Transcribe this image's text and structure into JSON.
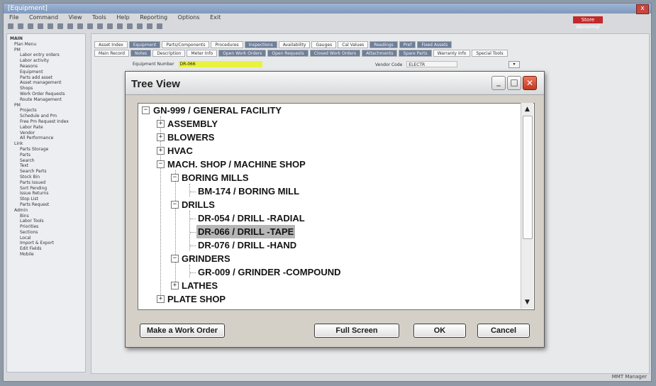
{
  "app": {
    "title": "[Equipment]",
    "close_glyph": "x",
    "alert_label": "Store Abnormal",
    "menu": [
      "File",
      "Command",
      "View",
      "Tools",
      "Help",
      "Reporting",
      "Options",
      "Exit"
    ],
    "status_text": "MMT Manager"
  },
  "sidebar": {
    "items": [
      {
        "label": "MAIN",
        "level": 0
      },
      {
        "label": "Plan Menu",
        "level": 1
      },
      {
        "label": "PM",
        "level": 1
      },
      {
        "label": "Labor entry orders",
        "level": 2
      },
      {
        "label": "Labor activity",
        "level": 2
      },
      {
        "label": "Reasons",
        "level": 2
      },
      {
        "label": "Equipment",
        "level": 2
      },
      {
        "label": "Parts add asset",
        "level": 2
      },
      {
        "label": "Asset management",
        "level": 2
      },
      {
        "label": "Shops",
        "level": 2
      },
      {
        "label": "Work Order Requests",
        "level": 2
      },
      {
        "label": "Route Management",
        "level": 2
      },
      {
        "label": "PM",
        "level": 1
      },
      {
        "label": "Projects",
        "level": 2
      },
      {
        "label": "Schedule and Pm",
        "level": 2
      },
      {
        "label": "Free Pm Request Index",
        "level": 2
      },
      {
        "label": "Labor Rate",
        "level": 2
      },
      {
        "label": "Vendor",
        "level": 2
      },
      {
        "label": "All Performance",
        "level": 2
      },
      {
        "label": "Link",
        "level": 1
      },
      {
        "label": "Parts Storage",
        "level": 2
      },
      {
        "label": "Parts",
        "level": 2
      },
      {
        "label": "Search",
        "level": 2
      },
      {
        "label": "Text",
        "level": 2
      },
      {
        "label": "Search Parts",
        "level": 2
      },
      {
        "label": "Stock Bin",
        "level": 2
      },
      {
        "label": "Parts Issued",
        "level": 2
      },
      {
        "label": "Sort Pending",
        "level": 2
      },
      {
        "label": "Issue Returns",
        "level": 2
      },
      {
        "label": "Stop List",
        "level": 2
      },
      {
        "label": "Parts Request",
        "level": 2
      },
      {
        "label": "Admin",
        "level": 1
      },
      {
        "label": "Bins",
        "level": 2
      },
      {
        "label": "Labor Tools",
        "level": 2
      },
      {
        "label": "Priorities",
        "level": 2
      },
      {
        "label": "Sections",
        "level": 2
      },
      {
        "label": "Local",
        "level": 2
      },
      {
        "label": "Import & Export",
        "level": 2
      },
      {
        "label": "Edit Fields",
        "level": 2
      },
      {
        "label": "Mobile",
        "level": 2
      }
    ]
  },
  "main": {
    "tabs_row1": [
      {
        "label": "Asset Index",
        "dark": false
      },
      {
        "label": "Equipment",
        "dark": true
      },
      {
        "label": "Parts/Components",
        "dark": false
      },
      {
        "label": "Procedures",
        "dark": false
      },
      {
        "label": "Inspections",
        "dark": true
      },
      {
        "label": "Availability",
        "dark": false
      },
      {
        "label": "Gauges",
        "dark": false
      },
      {
        "label": "Cal Values",
        "dark": false
      },
      {
        "label": "Readings",
        "dark": true
      },
      {
        "label": "Pref",
        "dark": true
      },
      {
        "label": "Fixed Assets",
        "dark": true
      }
    ],
    "tabs_row2": [
      {
        "label": "Main Record",
        "dark": false
      },
      {
        "label": "Notes",
        "dark": true
      },
      {
        "label": "Description",
        "dark": false
      },
      {
        "label": "Meter Info",
        "dark": false
      },
      {
        "label": "Open Work Orders",
        "dark": true
      },
      {
        "label": "Open Requests",
        "dark": true
      },
      {
        "label": "Closed Work Orders",
        "dark": true
      },
      {
        "label": "Attachments",
        "dark": true
      },
      {
        "label": "Spare Parts",
        "dark": true
      },
      {
        "label": "Warranty Info",
        "dark": false
      },
      {
        "label": "Special Tools",
        "dark": false
      }
    ],
    "equipment_number_label": "Equipment Number",
    "equipment_number_value": "DR-066",
    "vendor_code_label": "Vendor Code",
    "vendor_code_value": "ELECTR",
    "vendor_arrow": "▾"
  },
  "dialog": {
    "title": "Tree View",
    "min_glyph": "_",
    "max_glyph": "□",
    "close_glyph": "✕",
    "tree": [
      {
        "label": "GN-999 / GENERAL FACILITY",
        "exp": "−"
      },
      {
        "label": "ASSEMBLY",
        "exp": "+"
      },
      {
        "label": "BLOWERS",
        "exp": "+"
      },
      {
        "label": "HVAC",
        "exp": "+"
      },
      {
        "label": "MACH. SHOP / MACHINE SHOP",
        "exp": "−"
      },
      {
        "label": "BORING MILLS",
        "exp": "−"
      },
      {
        "label": "BM-174 / BORING MILL",
        "exp": ""
      },
      {
        "label": "DRILLS",
        "exp": "−"
      },
      {
        "label": "DR-054 / DRILL -RADIAL",
        "exp": ""
      },
      {
        "label": "DR-066 / DRILL -TAPE",
        "exp": ""
      },
      {
        "label": "DR-076 / DRILL -HAND",
        "exp": ""
      },
      {
        "label": "GRINDERS",
        "exp": "−"
      },
      {
        "label": "GR-009 / GRINDER -COMPOUND",
        "exp": ""
      },
      {
        "label": "LATHES",
        "exp": "+"
      },
      {
        "label": "PLATE SHOP",
        "exp": "+"
      }
    ],
    "scroll_up": "▲",
    "scroll_down": "▼",
    "buttons": {
      "work_order": "Make a Work Order",
      "full_screen": "Full Screen",
      "ok": "OK",
      "cancel": "Cancel"
    }
  }
}
